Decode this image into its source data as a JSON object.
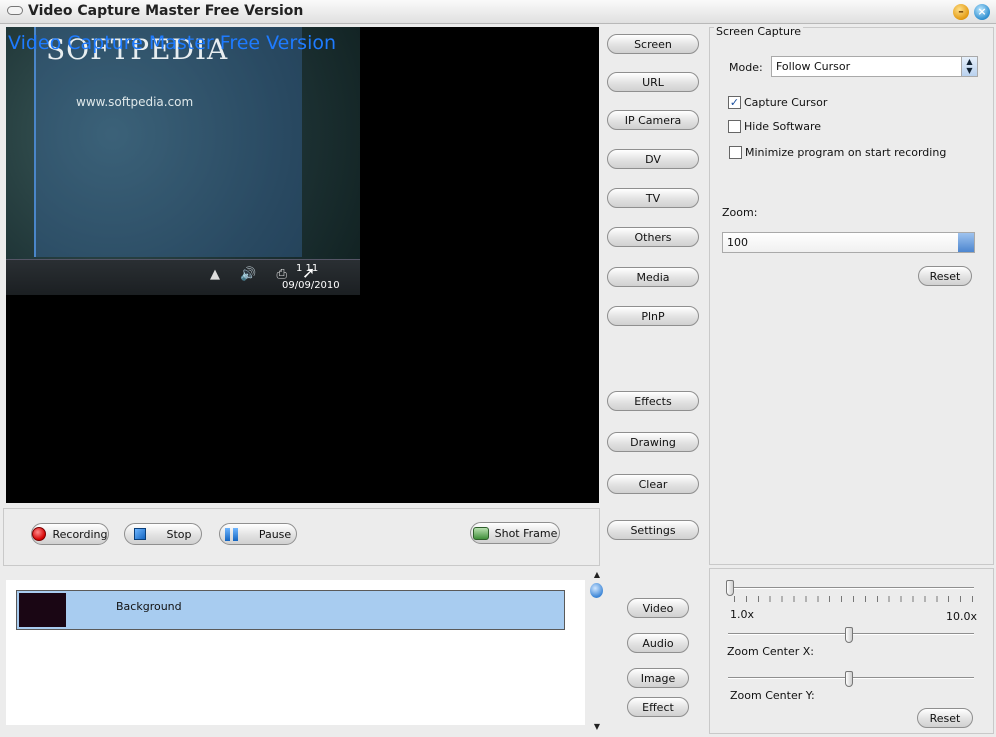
{
  "window": {
    "title": "Video Capture Master Free Version"
  },
  "preview": {
    "caption": "Video Capture Master Free Version",
    "logo_text": "SOFTPEDIA",
    "site_url": "www.softpedia.com",
    "clock_time": "1 11",
    "clock_date": "09/09/2010",
    "tray_icons": "▲ 🔊 ⎙"
  },
  "side_buttons": {
    "screen": "Screen",
    "url": "URL",
    "ip_camera": "IP Camera",
    "dv": "DV",
    "tv": "TV",
    "others": "Others",
    "media": "Media",
    "pnp": "PlnP",
    "effects": "Effects",
    "drawing": "Drawing",
    "clear": "Clear",
    "settings": "Settings"
  },
  "record_bar": {
    "recording": "Recording",
    "stop": "Stop",
    "pause": "Pause",
    "shot_frame": "Shot Frame"
  },
  "screen_capture": {
    "title": "Screen Capture",
    "mode_label": "Mode:",
    "mode_value": "Follow Cursor",
    "capture_cursor": {
      "label": "Capture Cursor",
      "checked": "✓"
    },
    "hide_software": {
      "label": "Hide Software",
      "checked": ""
    },
    "minimize_on_record": {
      "label": "Minimize program on start recording",
      "checked": ""
    },
    "zoom_label": "Zoom:",
    "zoom_value": "100",
    "reset": "Reset"
  },
  "timeline": {
    "track_label": "Background"
  },
  "track_buttons": {
    "video": "Video",
    "audio": "Audio",
    "image": "Image",
    "effect": "Effect"
  },
  "zoom_controls": {
    "zoom_min": "1.0x",
    "zoom_max": "10.0x",
    "zoom_level": 0.0,
    "center_x_label": "Zoom Center X:",
    "center_x_level": 0.5,
    "center_y_label": "Zoom Center Y:",
    "center_y_level": 0.5,
    "reset": "Reset"
  },
  "colors": {
    "caption_blue": "#1e7bff",
    "track_selected": "#a8ccf0"
  }
}
